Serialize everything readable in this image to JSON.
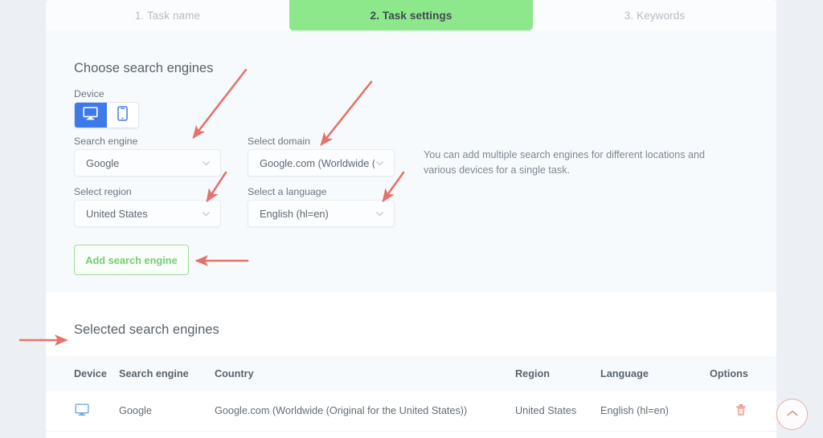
{
  "wizard": {
    "tabs": [
      {
        "label": "1. Task name",
        "active": false
      },
      {
        "label": "2. Task settings",
        "active": true
      },
      {
        "label": "3. Keywords",
        "active": false
      }
    ]
  },
  "choose_section": {
    "title": "Choose search engines",
    "device": {
      "label": "Device",
      "options": [
        "desktop-icon",
        "mobile-icon"
      ],
      "selected": "desktop-icon"
    },
    "fields": [
      {
        "label": "Search engine",
        "value": "Google"
      },
      {
        "label": "Select domain",
        "value": "Google.com (Worldwide (…"
      },
      {
        "label": "Select region",
        "value": "United States"
      },
      {
        "label": "Select a language",
        "value": "English (hl=en)"
      }
    ],
    "note": "You can add multiple search engines for different locations and various devices for a single task.",
    "add_button": "Add search engine"
  },
  "selected_section": {
    "title": "Selected search engines",
    "columns": [
      "Device",
      "Search engine",
      "Country",
      "Region",
      "Language",
      "Options"
    ],
    "rows": [
      {
        "device": "desktop-icon",
        "search_engine": "Google",
        "country": "Google.com (Worldwide (Original for the United States))",
        "region": "United States",
        "language": "English (hl=en)",
        "options": "delete-icon"
      }
    ]
  },
  "fab": {
    "icon": "chevron-up-icon"
  },
  "colors": {
    "active_tab_green": "#8ce88a",
    "device_blue": "#3d7ae8",
    "add_button_green": "#74cf72",
    "annotation_red": "#e2746b",
    "delete_red": "#e89a8c",
    "panel_bg": "#f7fafc"
  },
  "annotations": {
    "arrow_count": 6,
    "color": "#e2746b"
  }
}
